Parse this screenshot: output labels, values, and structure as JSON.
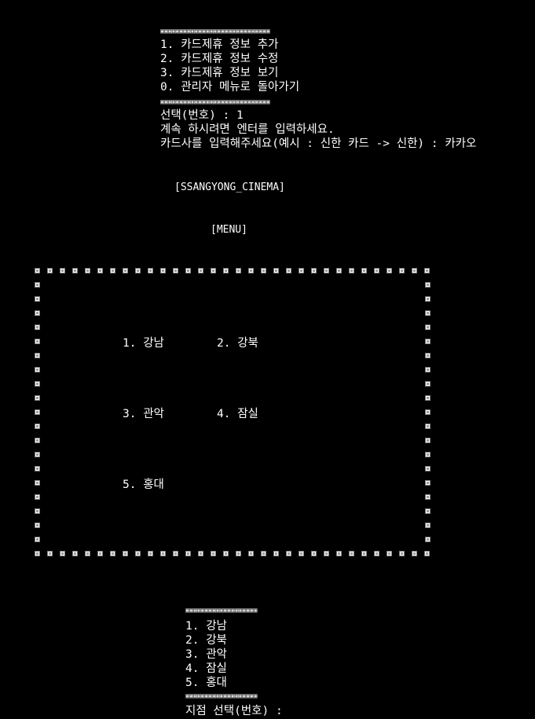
{
  "colors": {
    "background": "#000000",
    "text": "#ffffff",
    "border": "#d8d8d8"
  },
  "card_menu": {
    "separator": "▣▣▣▣▣▣▣▣▣▣▣▣▣▣▣▣▣▣▣▣▣▣▣▣▣▣▣▣▣",
    "items": [
      "1. 카드제휴 정보 추가",
      "2. 카드제휴 정보 수정",
      "3. 카드제휴 정보 보기",
      "0. 관리자 메뉴로 돌아가기"
    ],
    "prompt_select": "선택(번호) : 1",
    "prompt_continue": "계속 하시려면 엔터를 입력하세요.",
    "prompt_card": "카드사를 입력해주세요(예시 : 신한 카드 -> 신한) : 카카오"
  },
  "title": "[SSANGYONG_CINEMA]",
  "menu_label": "[MENU]",
  "branch_box": {
    "border_icon": "square-dot-icon",
    "rows": [
      [
        "1. 강남",
        "2. 강북"
      ],
      [
        "3. 관악",
        "4. 잠실"
      ],
      [
        "5. 홍대",
        ""
      ]
    ]
  },
  "branch_list": {
    "separator": "▣▣▣▣▣▣▣▣▣▣▣▣▣▣▣▣▣▣▣",
    "items": [
      "1. 강남",
      "2. 강북",
      "3. 관악",
      "4. 잠실",
      "5. 홍대"
    ],
    "prompt": "지점 선택(번호) :"
  }
}
